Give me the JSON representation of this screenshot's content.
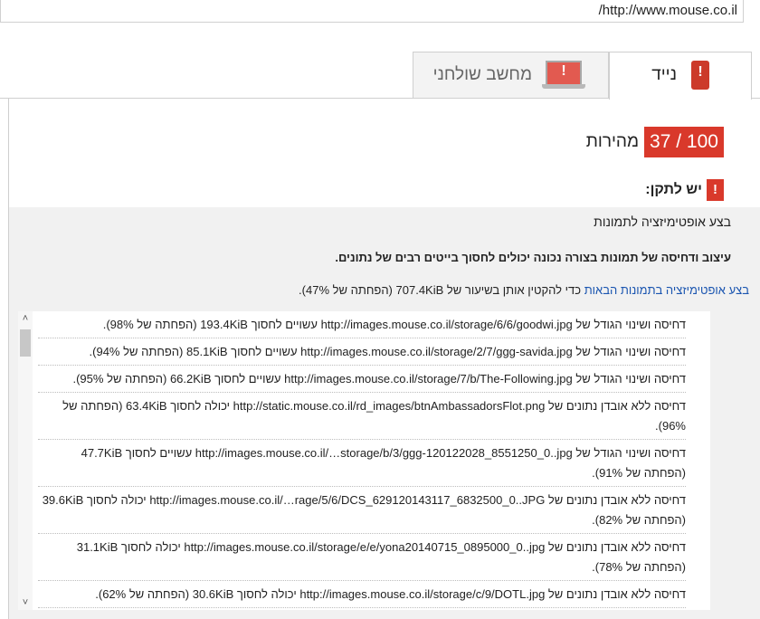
{
  "url": "/http://www.mouse.co.il",
  "tabs": {
    "mobile": "נייד",
    "desktop": "מחשב שולחני"
  },
  "score": {
    "value": "37 / 100",
    "label": "מהירות"
  },
  "should_fix": {
    "label": "יש לתקן:"
  },
  "rule": {
    "title": "בצע אופטימיזציה לתמונות",
    "description": "עיצוב ודחיסה של תמונות בצורה נכונה יכולים לחסוך בייטים רבים של נתונים.",
    "action_link": "בצע אופטימיזציה בתמונות הבאות",
    "action_rest": " כדי להקטין אותן בשיעור של 707.4KiB (הפחתה של 47%)."
  },
  "items": [
    "דחיסה ושינוי הגודל של http://images.mouse.co.il/storage/6/6/goodwi.jpg עשויים לחסוך 193.4KiB (הפחתה של 98%).",
    "דחיסה ושינוי הגודל של http://images.mouse.co.il/storage/2/7/ggg-savida.jpg עשויים לחסוך 85.1KiB (הפחתה של 94%).",
    "דחיסה ושינוי הגודל של http://images.mouse.co.il/storage/7/b/The-Following.jpg עשויים לחסוך 66.2KiB (הפחתה של 95%).",
    "דחיסה ללא אובדן נתונים של http://static.mouse.co.il/rd_images/btnAmbassadorsFlot.png יכולה לחסוך 63.4KiB (הפחתה של 96%).",
    "דחיסה ושינוי הגודל של http://images.mouse.co.il/…storage/b/3/ggg-120122028_8551250_0..jpg עשויים לחסוך 47.7KiB (הפחתה של 91%).",
    "דחיסה ללא אובדן נתונים של http://images.mouse.co.il/…rage/5/6/DCS_629120143117_6832500_0..JPG יכולה לחסוך 39.6KiB (הפחתה של 82%).",
    "דחיסה ללא אובדן נתונים של http://images.mouse.co.il/storage/e/e/yona20140715_0895000_0..jpg יכולה לחסוך 31.1KiB (הפחתה של 78%).",
    "דחיסה ללא אובדן נתונים של http://images.mouse.co.il/storage/c/9/DOTL.jpg יכולה לחסוך 30.6KiB (הפחתה של 62%)."
  ],
  "colors": {
    "danger": "#d9392b",
    "link": "#1a55b0"
  },
  "icons": {
    "mobile": "mobile-warning-icon",
    "desktop": "desktop-warning-icon",
    "fix": "exclamation-icon"
  }
}
